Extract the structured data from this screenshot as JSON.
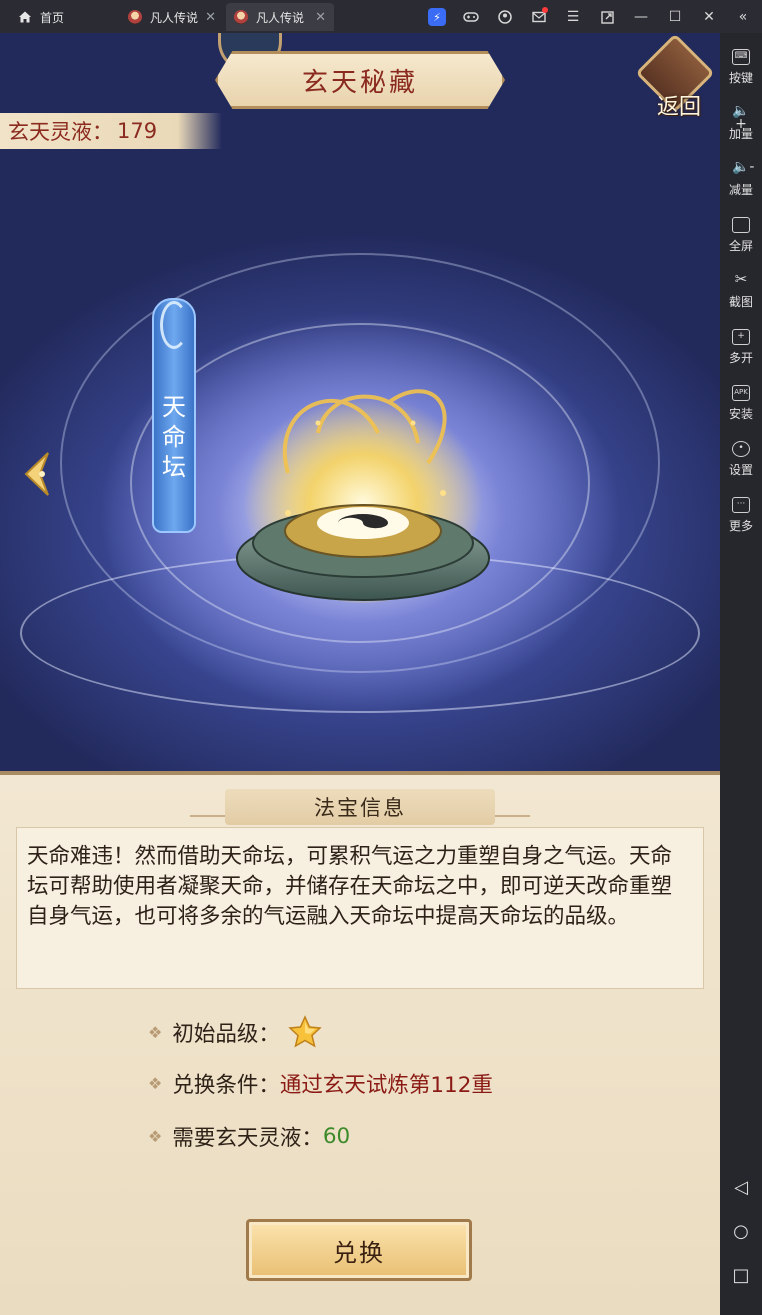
{
  "window": {
    "tabs": [
      {
        "label": "首页"
      },
      {
        "label": "凡人传说"
      },
      {
        "label": "凡人传说"
      }
    ]
  },
  "sidebar": {
    "items": [
      {
        "label": "按键"
      },
      {
        "label": "加量"
      },
      {
        "label": "减量"
      },
      {
        "label": "全屏"
      },
      {
        "label": "截图"
      },
      {
        "label": "多开"
      },
      {
        "label": "安装"
      },
      {
        "label": "设置"
      },
      {
        "label": "更多"
      }
    ]
  },
  "game": {
    "title": "玄天秘藏",
    "back_label": "返回",
    "currency_label": "玄天灵液：",
    "currency_value": "179",
    "artifact_name_chars": [
      "天",
      "命",
      "坛"
    ],
    "info_panel": {
      "header": "法宝信息",
      "description": "天命难违！然而借助天命坛，可累积气运之力重塑自身之气运。天命坛可帮助使用者凝聚天命，并储存在天命坛之中，即可逆天改命重塑自身气运，也可将多余的气运融入天命坛中提高天命坛的品级。",
      "attributes": {
        "initial_grade_label": "初始品级：",
        "initial_grade_stars": 1,
        "exchange_cond_label": "兑换条件：",
        "exchange_cond_value": "通过玄天试炼第112重",
        "required_label": "需要玄天灵液：",
        "required_value": "60"
      },
      "exchange_button": "兑换"
    }
  },
  "colors": {
    "title_red": "#8a2a1e",
    "condition_red": "#8b1a14",
    "amount_green": "#3c8a2a",
    "panel_bg": "#f2e7d2"
  }
}
